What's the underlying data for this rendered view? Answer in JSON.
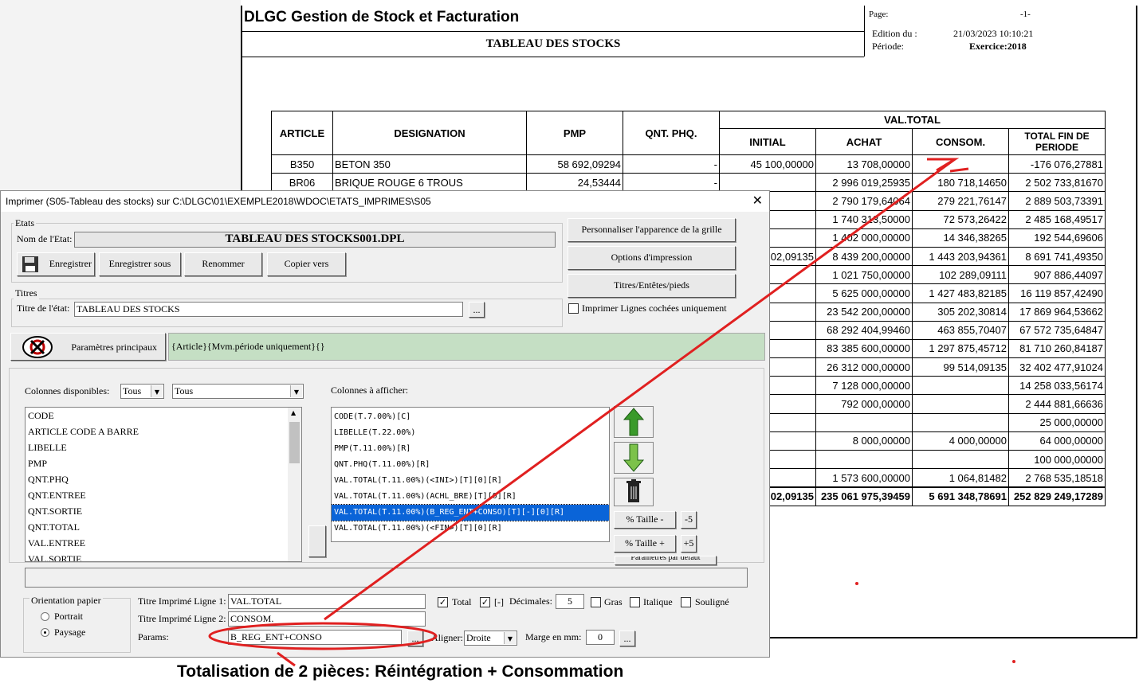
{
  "report": {
    "app_title": "DLGC Gestion de Stock et Facturation",
    "subtitle": "TABLEAU DES STOCKS",
    "page_label": "Page:",
    "page_value": "-1-",
    "edition_label": "Edition du :",
    "edition_value": "21/03/2023 10:10:21",
    "periode_label": "Période:",
    "periode_value": "Exercice:2018",
    "headers": {
      "article": "ARTICLE",
      "designation": "DESIGNATION",
      "pmp": "PMP",
      "qnt": "QNT. PHQ.",
      "val_total": "VAL.TOTAL",
      "initial": "INITIAL",
      "achat": "ACHAT",
      "consom": "CONSOM.",
      "total_fin": "TOTAL FIN DE PERIODE"
    },
    "rows": [
      {
        "article": "B350",
        "designation": "BETON 350",
        "pmp": "58 692,09294",
        "qnt": "-",
        "initial": "45 100,00000",
        "achat": "13 708,00000",
        "consom": "",
        "total": "-176 076,27881"
      },
      {
        "article": "BR06",
        "designation": "BRIQUE ROUGE 6 TROUS",
        "pmp": "24,53444",
        "qnt": "-",
        "initial": "",
        "achat": "2 996 019,25935",
        "consom": "180 718,14650",
        "total": "2 502 733,81670"
      },
      {
        "article": "",
        "designation": "",
        "pmp": "",
        "qnt": "",
        "initial": "",
        "achat": "2 790 179,64064",
        "consom": "279 221,76147",
        "total": "2 889 503,73391"
      },
      {
        "article": "",
        "designation": "",
        "pmp": "",
        "qnt": "",
        "initial": "",
        "achat": "1 740 313,50000",
        "consom": "72 573,26422",
        "total": "2 485 168,49517"
      },
      {
        "article": "",
        "designation": "",
        "pmp": "",
        "qnt": "",
        "initial": "",
        "achat": "1 402 000,00000",
        "consom": "14 346,38265",
        "total": "192 544,69606"
      },
      {
        "article": "",
        "designation": "",
        "pmp": "",
        "qnt": "",
        "initial": "02,09135",
        "achat": "8 439 200,00000",
        "consom": "1 443 203,94361",
        "total": "8 691 741,49350"
      },
      {
        "article": "",
        "designation": "",
        "pmp": "",
        "qnt": "",
        "initial": "",
        "achat": "1 021 750,00000",
        "consom": "102 289,09111",
        "total": "907 886,44097"
      },
      {
        "article": "",
        "designation": "",
        "pmp": "",
        "qnt": "",
        "initial": "",
        "achat": "5 625 000,00000",
        "consom": "1 427 483,82185",
        "total": "16 119 857,42490"
      },
      {
        "article": "",
        "designation": "",
        "pmp": "",
        "qnt": "",
        "initial": "",
        "achat": "23 542 200,00000",
        "consom": "305 202,30814",
        "total": "17 869 964,53662"
      },
      {
        "article": "",
        "designation": "",
        "pmp": "",
        "qnt": "",
        "initial": "",
        "achat": "68 292 404,99460",
        "consom": "463 855,70407",
        "total": "67 572 735,64847"
      },
      {
        "article": "",
        "designation": "",
        "pmp": "",
        "qnt": "",
        "initial": "",
        "achat": "83 385 600,00000",
        "consom": "1 297 875,45712",
        "total": "81 710 260,84187"
      },
      {
        "article": "",
        "designation": "",
        "pmp": "",
        "qnt": "",
        "initial": "",
        "achat": "26 312 000,00000",
        "consom": "99 514,09135",
        "total": "32 402 477,91024"
      },
      {
        "article": "",
        "designation": "",
        "pmp": "",
        "qnt": "",
        "initial": "",
        "achat": "7 128 000,00000",
        "consom": "",
        "total": "14 258 033,56174"
      },
      {
        "article": "",
        "designation": "",
        "pmp": "",
        "qnt": "",
        "initial": "",
        "achat": "792 000,00000",
        "consom": "",
        "total": "2 444 881,66636"
      },
      {
        "article": "",
        "designation": "",
        "pmp": "",
        "qnt": "",
        "initial": "",
        "achat": "",
        "consom": "",
        "total": "25 000,00000"
      },
      {
        "article": "",
        "designation": "",
        "pmp": "",
        "qnt": "",
        "initial": "",
        "achat": "8 000,00000",
        "consom": "4 000,00000",
        "total": "64 000,00000"
      },
      {
        "article": "",
        "designation": "",
        "pmp": "",
        "qnt": "",
        "initial": "",
        "achat": "",
        "consom": "",
        "total": "100 000,00000"
      },
      {
        "article": "",
        "designation": "",
        "pmp": "",
        "qnt": "",
        "initial": "",
        "achat": "1 573 600,00000",
        "consom": "1 064,81482",
        "total": "2 768 535,18518"
      }
    ],
    "total_row": {
      "initial": "02,09135",
      "achat": "235 061 975,39459",
      "consom": "5 691 348,78691",
      "total": "252 829 249,17289"
    }
  },
  "dialog": {
    "title": "Imprimer (S05-Tableau des stocks)  sur C:\\DLGC\\01\\EXEMPLE2018\\WDOC\\ETATS_IMPRIMES\\S05",
    "close": "✕",
    "etats": {
      "group_label": "Etats",
      "nom_label": "Nom de l'Etat:",
      "nom_value": "TABLEAU DES STOCKS001.DPL",
      "btn_enregistrer": "Enregistrer",
      "btn_enregistrer_sous": "Enregistrer sous",
      "btn_renommer": "Renommer",
      "btn_copier": "Copier vers"
    },
    "right_buttons": {
      "personnaliser": "Personnaliser l'apparence de la grille",
      "options": "Options d'impression",
      "titres": "Titres/Entêtes/pieds",
      "chk_lignes": "Imprimer Lignes cochées uniquement"
    },
    "titres": {
      "group_label": "Titres",
      "titre_label": "Titre de l'état:",
      "titre_value": "TABLEAU DES STOCKS",
      "dots": "..."
    },
    "params_principaux": {
      "label": "Paramètres principaux",
      "value": "{Article}{Mvm.période uniquement}{}"
    },
    "colonnes": {
      "dispo_label": "Colonnes disponibles:",
      "filter1": "Tous",
      "filter2": "Tous",
      "afficher_label": "Colonnes à afficher:",
      "available": [
        "CODE",
        "ARTICLE CODE A BARRE",
        "LIBELLE",
        "PMP",
        "QNT.PHQ",
        "QNT.ENTREE",
        "QNT.SORTIE",
        "QNT.TOTAL",
        "VAL.ENTREE",
        "VAL.SORTIE"
      ],
      "shown": [
        "CODE(T.7.00%)[C]",
        "LIBELLE(T.22.00%)",
        "PMP(T.11.00%)[R]",
        "QNT.PHQ(T.11.00%)[R]",
        "VAL.TOTAL(T.11.00%)(<INI>)[T][0][R]",
        "VAL.TOTAL(T.11.00%)(ACHL_BRE)[T][0][R]",
        "VAL.TOTAL(T.11.00%)(B_REG_ENT+CONSO)[T][-][0][R]",
        "VAL.TOTAL(T.11.00%)(<FIN>)[T][0][R]"
      ],
      "selected_index": 6,
      "taille_minus": "% Taille -",
      "taille_plus": "% Taille +",
      "minus5": "-5",
      "plus5": "+5",
      "params_defaut": "Paramètres par défaut"
    },
    "orientation": {
      "label": "Orientation papier",
      "portrait": "Portrait",
      "paysage": "Paysage"
    },
    "ligne1_label": "Titre Imprimé Ligne 1:",
    "ligne1_value": "VAL.TOTAL",
    "ligne2_label": "Titre Imprimé Ligne 2:",
    "ligne2_value": "CONSOM.",
    "params_label": "Params:",
    "params_value": "B_REG_ENT+CONSO",
    "total_label": "Total",
    "dash_label": "[-]",
    "decimales_label": "Décimales:",
    "decimales_value": "5",
    "gras_label": "Gras",
    "italique_label": "Italique",
    "souligne_label": "Souligné",
    "aligner_label": "Aligner:",
    "aligner_value": "Droite",
    "marge_label": "Marge en mm:",
    "marge_value": "0"
  },
  "annotation": {
    "caption": "Totalisation de 2 pièces: Réintégration + Consommation",
    "color": "#e02020"
  }
}
